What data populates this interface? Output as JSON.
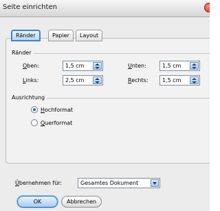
{
  "window": {
    "title": "Seite einrichten"
  },
  "tabs": [
    {
      "label": "Ränder",
      "active": true
    },
    {
      "label": "Papier",
      "active": false
    },
    {
      "label": "Layout",
      "active": false
    }
  ],
  "margins": {
    "group_label": "Ränder",
    "top": {
      "label": "Oben:",
      "value": "1,5 cm"
    },
    "bottom": {
      "label": "Unten:",
      "value": "1,5 cm"
    },
    "left": {
      "label": "Links:",
      "value": "2,5 cm"
    },
    "right": {
      "label": "Rechts:",
      "value": "1,5 cm"
    }
  },
  "orientation": {
    "group_label": "Ausrichtung",
    "options": [
      {
        "label": "Hochformat",
        "selected": true
      },
      {
        "label": "Querformat",
        "selected": false
      }
    ]
  },
  "apply_to": {
    "label": "Übernehmen für:",
    "value": "Gesamtes Dokument"
  },
  "buttons": {
    "ok": "OK",
    "cancel": "Abbrechen"
  },
  "colors": {
    "accent": "#3f83c9",
    "close": "#d42a1e"
  }
}
